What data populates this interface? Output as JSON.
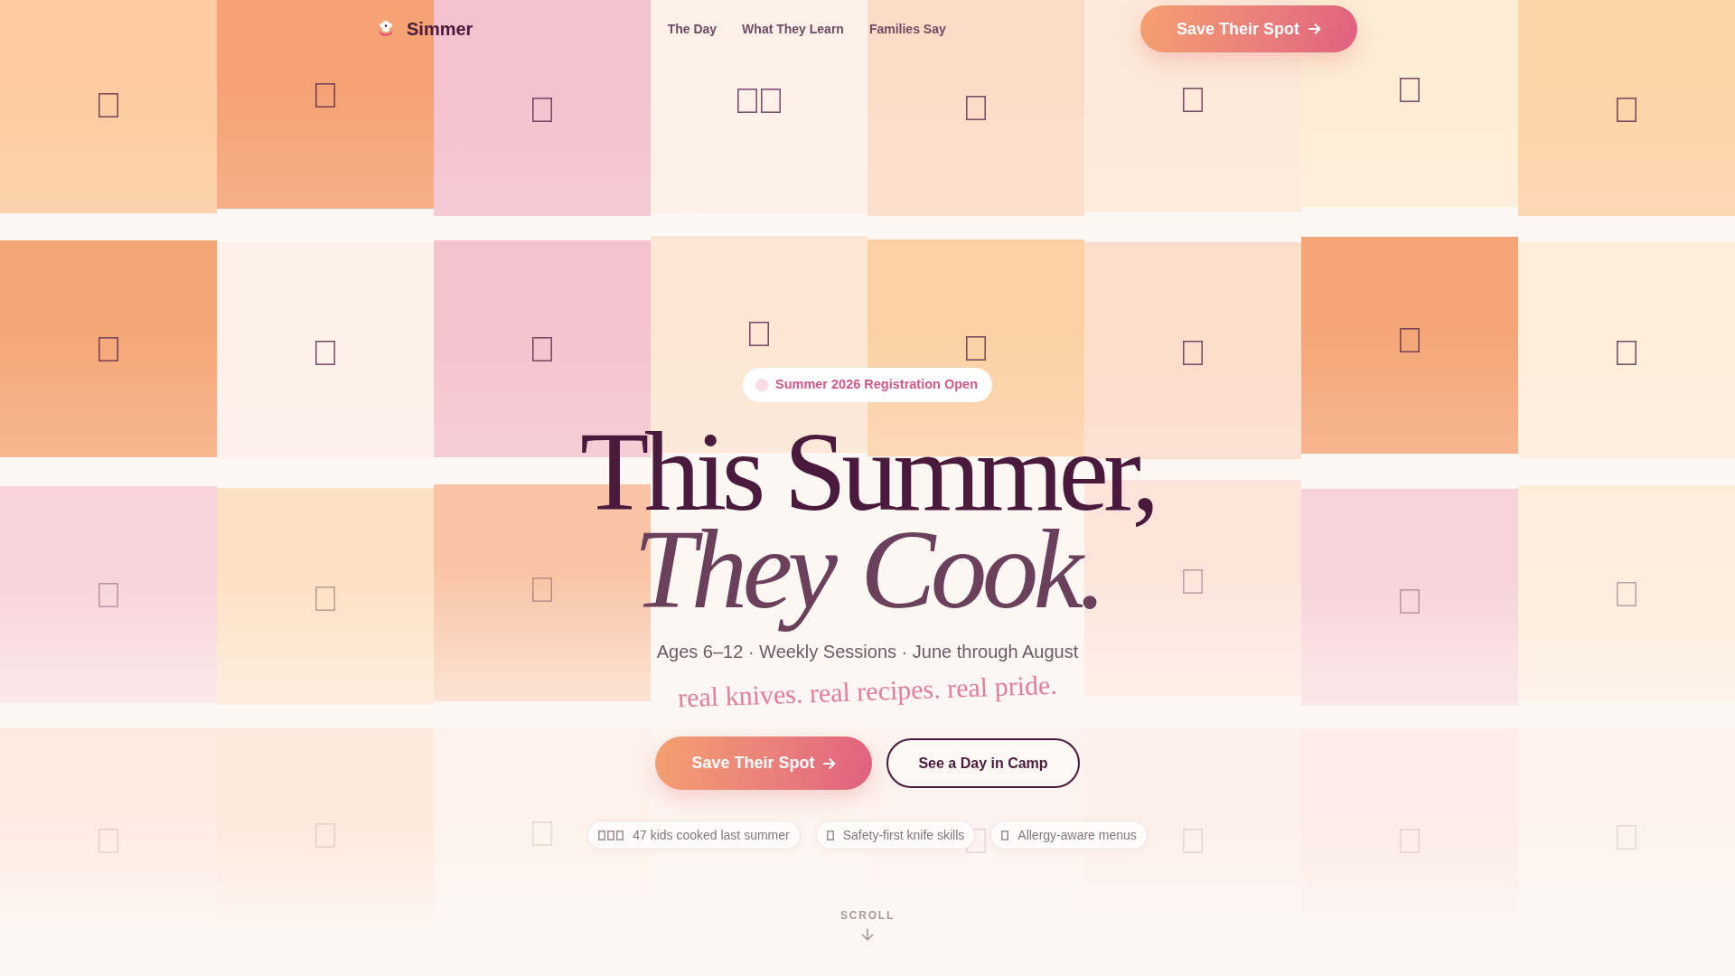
{
  "nav": {
    "brand": "Simmer",
    "links": [
      {
        "label": "The Day"
      },
      {
        "label": "What They Learn"
      },
      {
        "label": "Families Say"
      }
    ],
    "cta": "Save Their Spot"
  },
  "hero": {
    "badge": "Summer 2026 Registration Open",
    "title": {
      "line_1": "This Summer,",
      "line_2": "They Cook."
    },
    "subtitle": "Ages 6–12 · Weekly Sessions · June through August",
    "tagline": "real knives. real recipes. real pride.",
    "buttons": [
      {
        "kind": "primary",
        "label": "Save Their Spot"
      },
      {
        "kind": "outline",
        "label": "See a Day in Camp"
      }
    ],
    "highlights": [
      {
        "text": "47 kids cooked last summer"
      },
      {
        "text": "Safety-first knife skills"
      },
      {
        "text": "Allergy-aware menus"
      }
    ]
  },
  "scroll_hint": "SCROLL"
}
